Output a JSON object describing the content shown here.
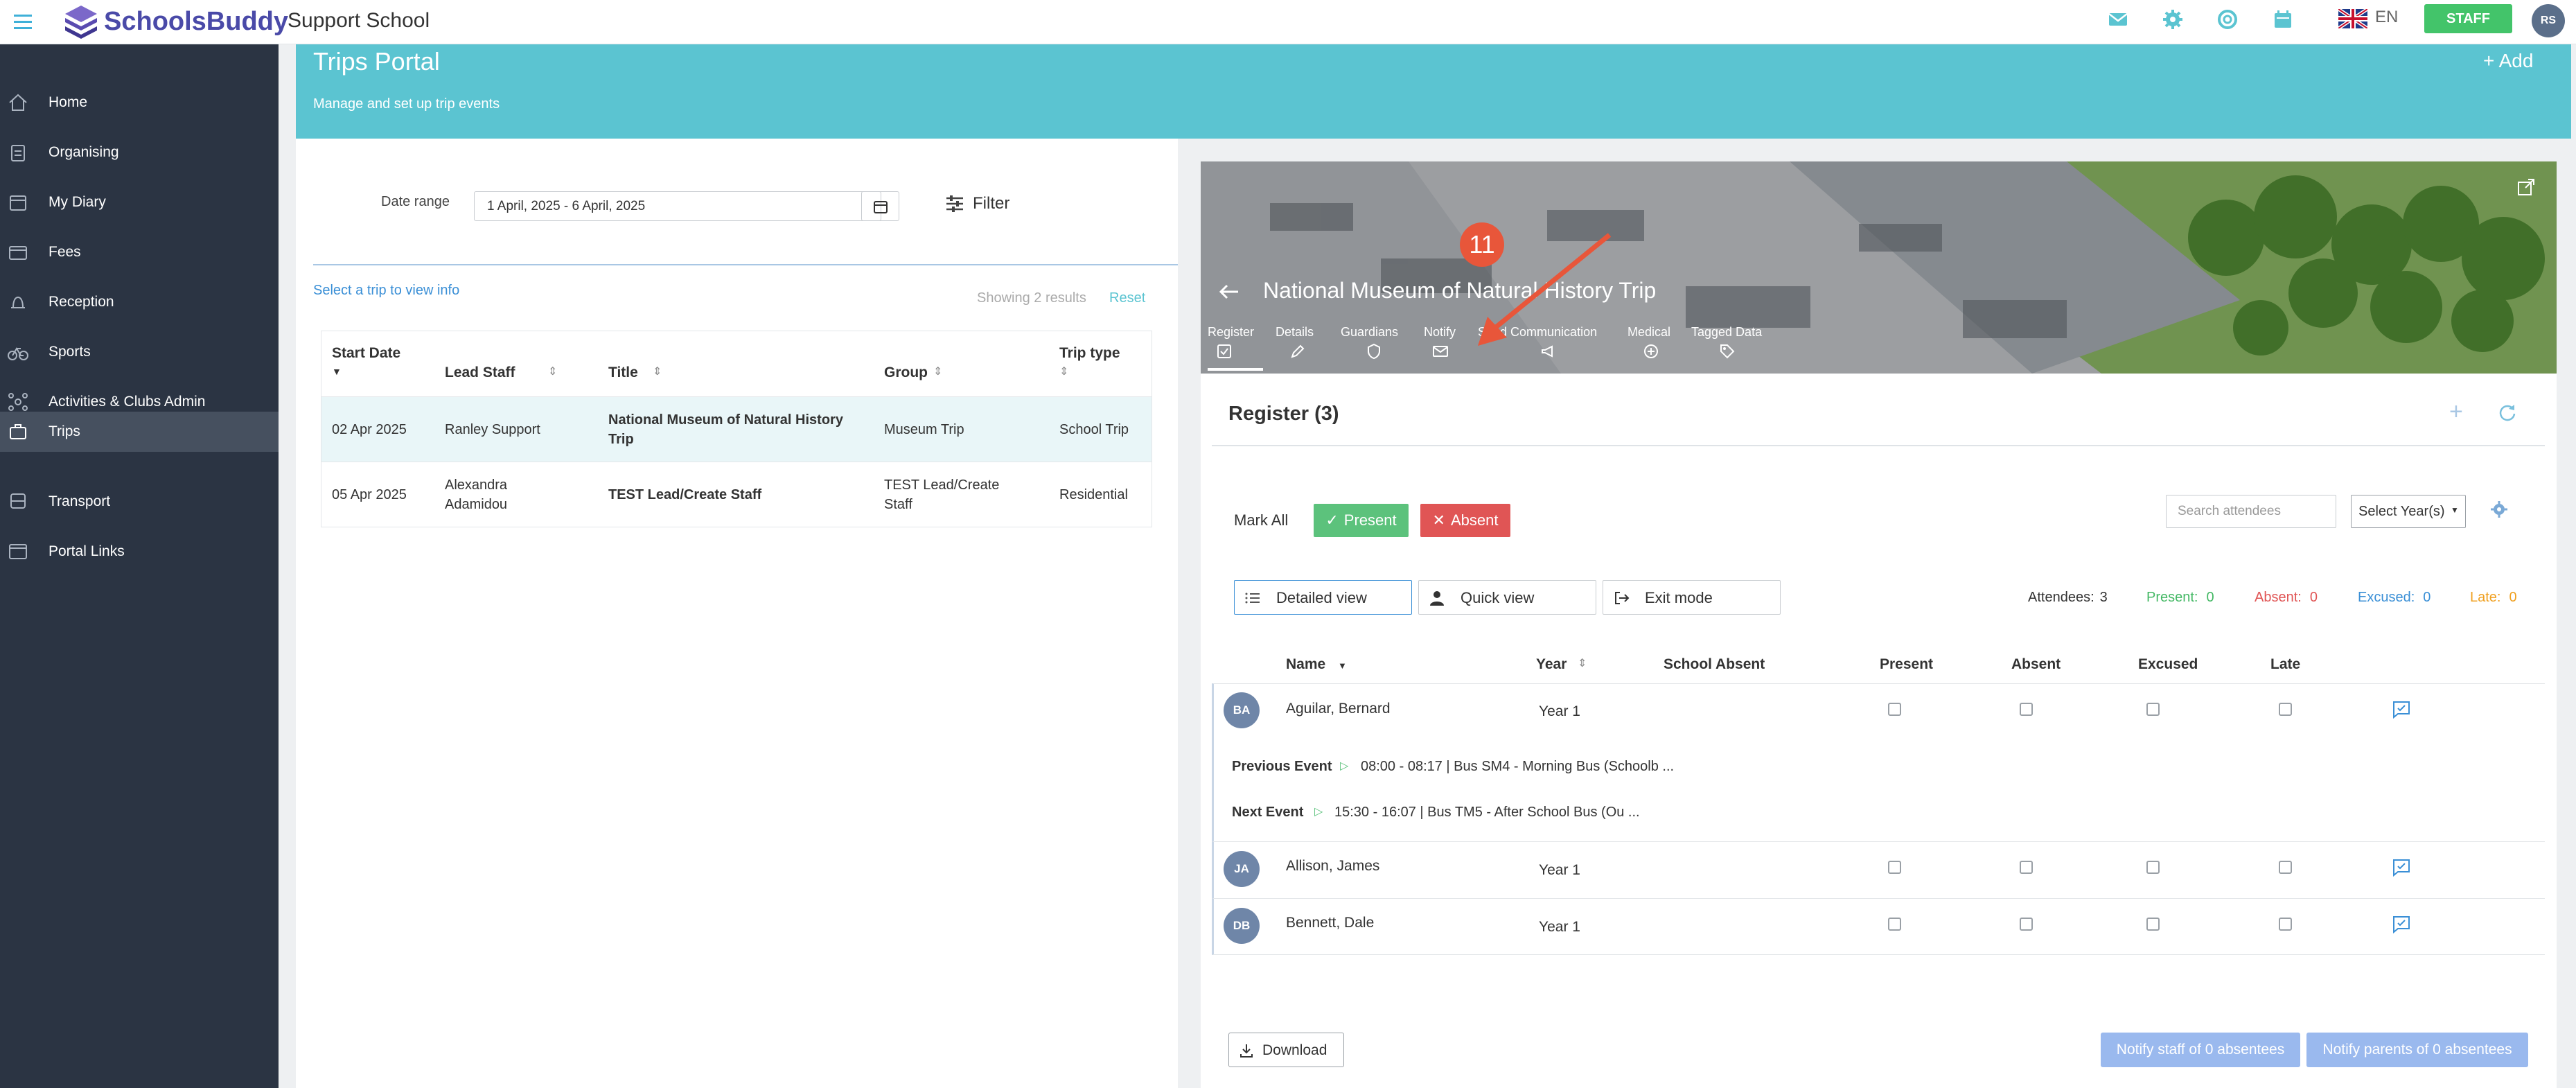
{
  "topbar": {
    "brand": "SchoolsBuddy",
    "school": "Support School",
    "lang": "EN",
    "staff_label": "STAFF",
    "avatar": "RS",
    "icons": [
      "mail-icon",
      "gear-icon",
      "help-icon",
      "calendar-icon"
    ]
  },
  "sidebar": {
    "items": [
      {
        "label": "Home",
        "icon": "home-icon"
      },
      {
        "label": "Organising",
        "icon": "clipboard-icon"
      },
      {
        "label": "My Diary",
        "icon": "calendar-icon"
      },
      {
        "label": "Fees",
        "icon": "wallet-icon"
      },
      {
        "label": "Reception",
        "icon": "bell-icon"
      },
      {
        "label": "Sports",
        "icon": "bike-icon"
      },
      {
        "label": "Activities & Clubs Admin",
        "icon": "network-icon"
      },
      {
        "label": "Trips",
        "icon": "suitcase-icon"
      },
      {
        "label": "Transport",
        "icon": "bus-icon"
      },
      {
        "label": "Portal Links",
        "icon": "window-icon"
      }
    ]
  },
  "banner": {
    "title": "Trips Portal",
    "subtitle": "Manage and set up trip events",
    "add_label": "+ Add"
  },
  "filters": {
    "date_range_label": "Date range",
    "date_range_value": "1 April, 2025 - 6 April, 2025",
    "filter_label": "Filter",
    "select_prompt": "Select a trip to view info",
    "showing": "Showing 2 results",
    "reset": "Reset"
  },
  "trips_table": {
    "headers": [
      "Start Date",
      "Lead Staff",
      "Title",
      "Group",
      "Trip type"
    ],
    "rows": [
      {
        "date": "02 Apr 2025",
        "staff": "Ranley Support",
        "title_line1": "National Museum of Natural History",
        "title_line2": "Trip",
        "group": "Museum Trip",
        "group2": "",
        "type": "School Trip"
      },
      {
        "date": "05 Apr 2025",
        "staff": "Alexandra",
        "staff2": "Adamidou",
        "title_line1": "TEST Lead/Create Staff",
        "title_line2": "",
        "group": "TEST Lead/Create",
        "group2": "Staff",
        "type": "Residential"
      }
    ]
  },
  "trip_detail": {
    "title": "National Museum of Natural History Trip",
    "annotation_number": "11",
    "tabs": [
      {
        "label": "Register",
        "icon": "checkbox-icon"
      },
      {
        "label": "Details",
        "icon": "edit-icon"
      },
      {
        "label": "Guardians",
        "icon": "shield-icon"
      },
      {
        "label": "Notify",
        "icon": "envelope-icon"
      },
      {
        "label": "Send Communication",
        "icon": "megaphone-icon"
      },
      {
        "label": "Medical",
        "icon": "medical-icon"
      },
      {
        "label": "Tagged Data",
        "icon": "tag-icon"
      }
    ]
  },
  "register": {
    "title": "Register (3)",
    "mark_all": "Mark All",
    "present_btn": "Present",
    "absent_btn": "Absent",
    "search_placeholder": "Search attendees",
    "year_select": "Select Year(s)",
    "views": [
      "Detailed view",
      "Quick view",
      "Exit mode"
    ],
    "stats": {
      "attendees_label": "Attendees:",
      "attendees": "3",
      "present_label": "Present:",
      "present": "0",
      "absent_label": "Absent:",
      "absent": "0",
      "excused_label": "Excused:",
      "excused": "0",
      "late_label": "Late:",
      "late": "0"
    },
    "headers": [
      "Name",
      "Year",
      "School Absent",
      "Present",
      "Absent",
      "Excused",
      "Late"
    ],
    "students": [
      {
        "initials": "BA",
        "name": "Aguilar, Bernard",
        "year": "Year 1"
      },
      {
        "initials": "JA",
        "name": "Allison, James",
        "year": "Year 1"
      },
      {
        "initials": "DB",
        "name": "Bennett, Dale",
        "year": "Year 1"
      }
    ],
    "previous_event_label": "Previous Event",
    "previous_event": "08:00 - 08:17 | Bus SM4 - Morning Bus (Schoolb ...",
    "next_event_label": "Next Event",
    "next_event": "15:30 - 16:07 | Bus TM5 - After School Bus (Ou ...",
    "download": "Download",
    "notify_staff": "Notify staff of 0 absentees",
    "notify_parents": "Notify parents of 0 absentees"
  },
  "colors": {
    "banner": "#5bc4d1",
    "sidebar": "#2b3443",
    "present": "#5cc27c",
    "absent": "#e05555",
    "staff_badge": "#43c46a",
    "notify_btn": "#9ab9ee"
  }
}
